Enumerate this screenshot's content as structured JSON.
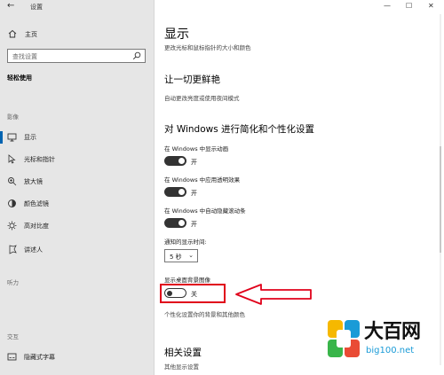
{
  "window": {
    "title": "设置",
    "back": "←",
    "controls": [
      "—",
      "☐",
      "✕"
    ]
  },
  "sidebar": {
    "home": "主页",
    "search_placeholder": "查找设置",
    "category": "轻松使用",
    "sections": {
      "vision": "影像",
      "hearing": "听力",
      "interaction": "交互"
    },
    "items": [
      {
        "label": "显示",
        "icon": "display-icon",
        "active": true
      },
      {
        "label": "光标和指针",
        "icon": "cursor-icon"
      },
      {
        "label": "放大镜",
        "icon": "magnifier-icon"
      },
      {
        "label": "颜色滤镜",
        "icon": "color-filter-icon"
      },
      {
        "label": "高对比度",
        "icon": "contrast-icon"
      },
      {
        "label": "讲述人",
        "icon": "narrator-icon"
      },
      {
        "label": "隐藏式字幕",
        "icon": "caption-icon"
      }
    ]
  },
  "main": {
    "title": "显示",
    "subtitle": "更改光标和鼠标指针的大小和颜色",
    "sec1_title": "让一切更鲜艳",
    "sec1_desc": "自动更改亮度或使用夜间模式",
    "sec2_title": "对 Windows 进行简化和个性化设置",
    "settings": [
      {
        "label": "在 Windows 中显示动画",
        "state": "开",
        "on": true
      },
      {
        "label": "在 Windows 中应用透明效果",
        "state": "开",
        "on": true
      },
      {
        "label": "在 Windows 中自动隐藏滚动条",
        "state": "开",
        "on": true
      }
    ],
    "notify_label": "通知的显示时间:",
    "notify_value": "5 秒",
    "bg_label": "显示桌面背景图像",
    "bg_state": "关",
    "bg_desc": "个性化设置你的背景和其他颜色",
    "related_title": "相关设置",
    "related_link": "其他显示设置"
  },
  "watermark": {
    "brand": "大百网",
    "url": "big100.net"
  },
  "colors": {
    "accent": "#0063b1",
    "highlight": "#e0001a",
    "toggle_on": "#333333"
  }
}
